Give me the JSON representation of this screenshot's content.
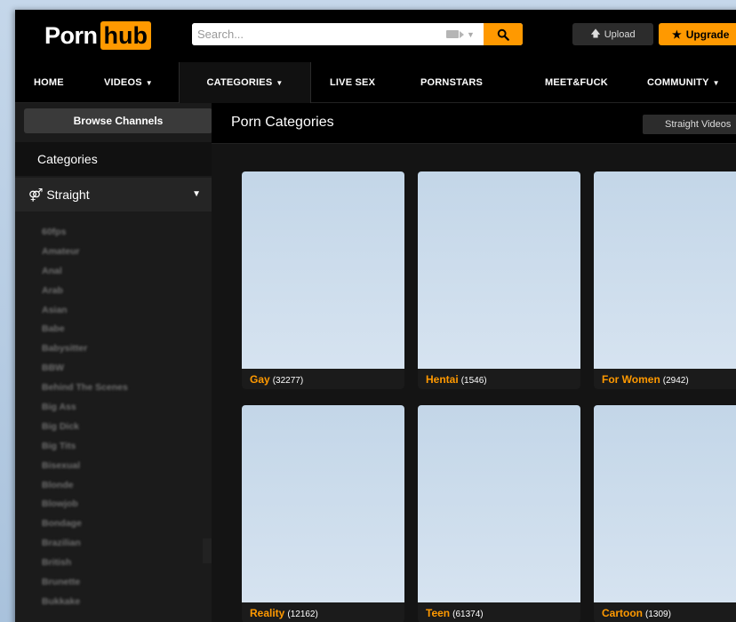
{
  "header": {
    "logo_left": "Porn",
    "logo_right": "hub",
    "search_placeholder": "Search...",
    "upload_label": "Upload",
    "upgrade_label": "Upgrade"
  },
  "nav": {
    "items": [
      {
        "label": "HOME",
        "dropdown": false
      },
      {
        "label": "VIDEOS",
        "dropdown": true
      },
      {
        "label": "CATEGORIES",
        "dropdown": true
      },
      {
        "label": "LIVE SEX",
        "dropdown": false
      },
      {
        "label": "PORNSTARS",
        "dropdown": false
      },
      {
        "label": "MEET&FUCK",
        "dropdown": false
      },
      {
        "label": "COMMUNITY",
        "dropdown": true
      }
    ],
    "active": "CATEGORIES"
  },
  "sidebar": {
    "browse_label": "Browse Channels",
    "heading": "Categories",
    "orientation": "Straight",
    "categories": [
      "60fps",
      "Amateur",
      "Anal",
      "Arab",
      "Asian",
      "Babe",
      "Babysitter",
      "BBW",
      "Behind The Scenes",
      "Big Ass",
      "Big Dick",
      "Big Tits",
      "Bisexual",
      "Blonde",
      "Blowjob",
      "Bondage",
      "Brazilian",
      "British",
      "Brunette",
      "Bukkake"
    ]
  },
  "main": {
    "title": "Porn Categories",
    "filter_label": "Straight Videos",
    "cards": [
      {
        "name": "Gay",
        "count": "(32277)"
      },
      {
        "name": "Hentai",
        "count": "(1546)"
      },
      {
        "name": "For Women",
        "count": "(2942)"
      },
      {
        "name": "Reality",
        "count": "(12162)"
      },
      {
        "name": "Teen",
        "count": "(61374)"
      },
      {
        "name": "Cartoon",
        "count": "(1309)"
      }
    ]
  },
  "colors": {
    "accent": "#ff9900",
    "background": "#000000",
    "sidebar": "#1b1b1b",
    "thumbnail_placeholder": "#c3d6e8"
  }
}
